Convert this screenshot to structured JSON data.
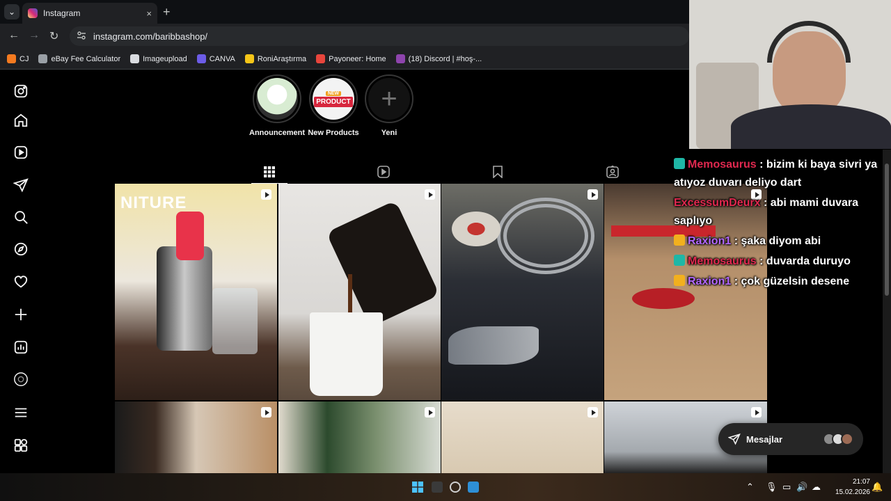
{
  "browser": {
    "tab_title": "Instagram",
    "tab_close": "×",
    "new_tab": "+",
    "url": "instagram.com/baribbashop/",
    "nav": {
      "back": "←",
      "forward": "→",
      "reload": "↻"
    },
    "bookmarks": [
      {
        "label": "CJ",
        "color": "#f47a20"
      },
      {
        "label": "eBay Fee Calculator",
        "color": "#9aa0a6"
      },
      {
        "label": "Imageupload",
        "color": "#dadce0"
      },
      {
        "label": "CANVA",
        "color": "#6c5ce7"
      },
      {
        "label": "RoniAraştırma",
        "color": "#f5c518"
      },
      {
        "label": "Payoneer: Home",
        "color": "#e8453c"
      },
      {
        "label": "(18) Discord | #hoş-...",
        "color": "#8e44ad"
      }
    ]
  },
  "instagram": {
    "highlights": [
      {
        "label": "Announcement",
        "color": "#e9f3e6"
      },
      {
        "label": "New Products",
        "color": "#d7263d",
        "badge_text": "PRODUCT",
        "badge_small": "NEW"
      },
      {
        "label": "Yeni",
        "plus": "+"
      }
    ],
    "posts_row1_overlay": "NITURE",
    "messages_label": "Mesajlar"
  },
  "chat": [
    {
      "badge": "gg",
      "user": "Memosaurus",
      "user_color": "#e0284f",
      "text": ": bizim ki baya sivri ya atıyoz duvarı deliyo dart"
    },
    {
      "badge": "",
      "user": "ExcessumDeurx",
      "user_color": "#e0284f",
      "text": ": abi mami duvara saplıyo"
    },
    {
      "badge": "crown",
      "user": "Raxion1",
      "user_color": "#b266ff",
      "text": ": şaka diyom abi"
    },
    {
      "badge": "gg",
      "user": "Memosaurus",
      "user_color": "#e0284f",
      "text": ": duvarda duruyo"
    },
    {
      "badge": "crown",
      "user": "Raxion1",
      "user_color": "#b266ff",
      "text": ": çok güzelsin desene"
    }
  ],
  "taskbar": {
    "time": "21:07",
    "date": "15.02.2026"
  }
}
